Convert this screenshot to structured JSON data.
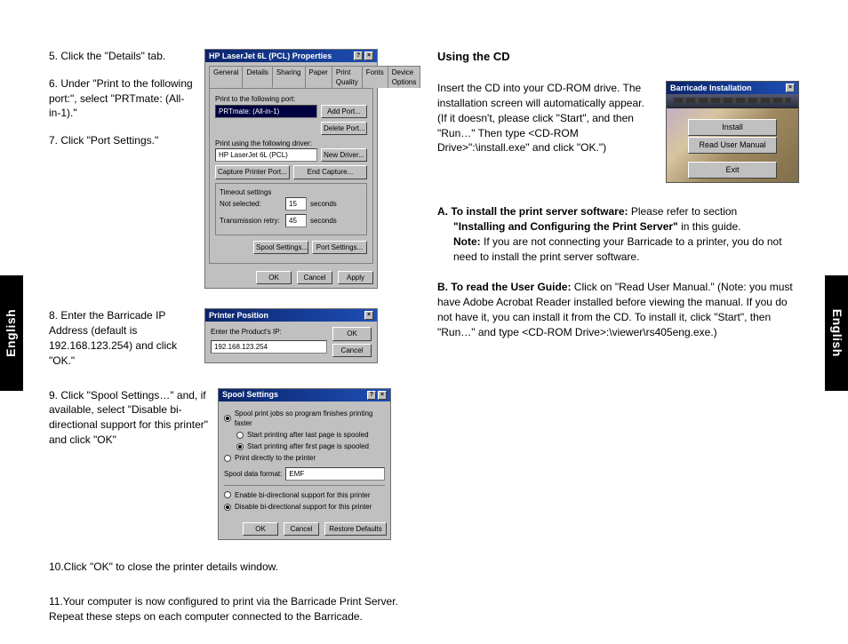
{
  "sidelabel": "English",
  "left": {
    "steps": {
      "s5": "5. Click the \"Details\" tab.",
      "s6": "6. Under \"Print to the following port:\", select \"PRTmate: (All-in-1).\"",
      "s7": "7. Click \"Port Settings.\"",
      "s8": "8. Enter the Barricade IP Address (default is 192.168.123.254) and click \"OK.\"",
      "s9": "9. Click \"Spool Settings…\" and, if available, select \"Disable bi-directional support for this printer\" and click \"OK\"",
      "s10": "10.Click \"OK\" to close the printer details window.",
      "s11": "11.Your computer is now configured to print via the Barricade Print Server.  Repeat these steps on each computer connected to the Barricade."
    },
    "dialog1": {
      "title": "HP LaserJet 6L (PCL) Properties",
      "tabs": [
        "General",
        "Details",
        "Sharing",
        "Paper",
        "Print Quality",
        "Fonts",
        "Device Options"
      ],
      "portLabel": "Print to the following port:",
      "portValue": "PRTmate: (All-in-1)",
      "addPort": "Add Port...",
      "deletePort": "Delete Port...",
      "driverLabel": "Print using the following driver:",
      "driverValue": "HP LaserJet 6L (PCL)",
      "newDriver": "New Driver...",
      "capture": "Capture Printer Port...",
      "endCapture": "End Capture...",
      "timeoutTitle": "Timeout settings",
      "notSelected": "Not selected:",
      "transmission": "Transmission retry:",
      "seconds": "seconds",
      "nsVal": "15",
      "trVal": "45",
      "spool": "Spool Settings...",
      "portSettings": "Port Settings...",
      "ok": "OK",
      "cancel": "Cancel",
      "apply": "Apply"
    },
    "dialog2": {
      "title": "Printer Position",
      "label": "Enter the Product's IP:",
      "value": "192.168.123.254",
      "ok": "OK",
      "cancel": "Cancel"
    },
    "dialog3": {
      "title": "Spool Settings",
      "opt1": "Spool print jobs so program finishes printing faster",
      "opt1a": "Start printing after last page is spooled",
      "opt1b": "Start printing after first page is spooled",
      "opt2": "Print directly to the printer",
      "sdfLabel": "Spool data format:",
      "sdfValue": "EMF",
      "opt3": "Enable bi-directional support for this printer",
      "opt4": "Disable bi-directional support for this printer",
      "ok": "OK",
      "cancel": "Cancel",
      "restore": "Restore Defaults"
    }
  },
  "right": {
    "heading": "Using the CD",
    "intro": "Insert the CD into your CD-ROM drive. The installation screen will automatically appear. (If it doesn't, please click \"Start\", and then \"Run…\" Then type <CD-ROM Drive>\":\\install.exe\" and click \"OK.\")",
    "installer": {
      "title": "Barricade Installation",
      "b1": "Install",
      "b2": "Read User Manual",
      "b3": "Exit"
    },
    "a_lead": "A. To install the print server software:",
    "a_rest1": " Please refer to section ",
    "a_bold": "\"Installing and Configuring the Print Server\"",
    "a_rest2": " in this guide. ",
    "a_note": "Note:",
    "a_note_rest": " If you are not connecting your Barricade to a printer, you do not need to install the print server software.",
    "b_lead": "B. To read the User Guide:",
    "b_rest": " Click on \"Read User Manual.\" (Note: you must have Adobe Acrobat Reader installed before viewing the manual.  If you do not have it, you can install it from the CD.  To install it, click \"Start\", then \"Run…\" and type <CD-ROM Drive>:\\viewer\\rs405eng.exe.)"
  }
}
